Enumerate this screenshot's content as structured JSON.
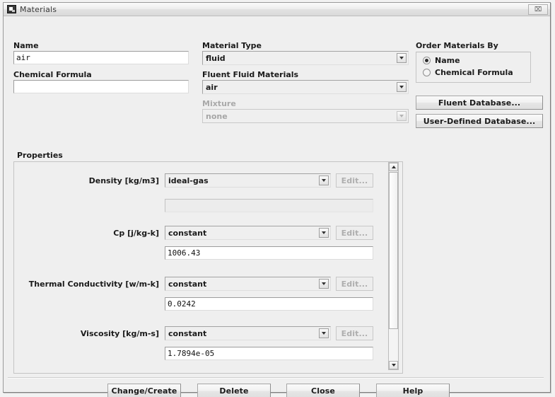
{
  "window": {
    "title": "Materials",
    "icon": "materials-window-icon",
    "close_label": "⌧"
  },
  "fields": {
    "name_label": "Name",
    "name_value": "air",
    "chemical_formula_label": "Chemical Formula",
    "chemical_formula_value": "",
    "material_type_label": "Material Type",
    "material_type_value": "fluid",
    "fluent_fluid_materials_label": "Fluent Fluid Materials",
    "fluent_fluid_materials_value": "air",
    "mixture_label": "Mixture",
    "mixture_value": "none"
  },
  "order_materials_by": {
    "title": "Order Materials By",
    "options": [
      {
        "label": "Name",
        "selected": true
      },
      {
        "label": "Chemical Formula",
        "selected": false
      }
    ]
  },
  "database_buttons": {
    "fluent": "Fluent Database...",
    "user_defined": "User-Defined Database..."
  },
  "properties": {
    "title": "Properties",
    "edit_label": "Edit...",
    "rows": [
      {
        "label": "Density [kg/m3]",
        "method": "ideal-gas",
        "value": "",
        "value_enabled": false,
        "edit_enabled": false
      },
      {
        "label": "Cp [j/kg-k]",
        "method": "constant",
        "value": "1006.43",
        "value_enabled": true,
        "edit_enabled": false
      },
      {
        "label": "Thermal Conductivity [w/m-k]",
        "method": "constant",
        "value": "0.0242",
        "value_enabled": true,
        "edit_enabled": false
      },
      {
        "label": "Viscosity [kg/m-s]",
        "method": "constant",
        "value": "1.7894e-05",
        "value_enabled": true,
        "edit_enabled": false
      }
    ]
  },
  "footer": {
    "change_create": "Change/Create",
    "delete": "Delete",
    "close": "Close",
    "help": "Help"
  },
  "colors": {
    "window_bg": "#efefef",
    "field_bg": "#ffffff",
    "disabled_text": "#a6a6a6",
    "text": "#1a1a1a"
  }
}
